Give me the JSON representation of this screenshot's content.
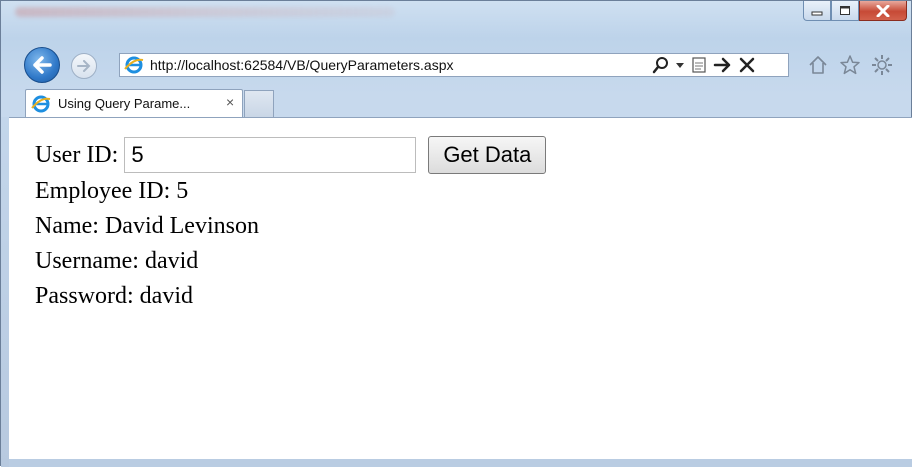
{
  "window": {
    "title_blurred": true,
    "controls": {
      "minimize": "minimize",
      "maximize": "maximize",
      "close": "close"
    }
  },
  "address_bar": {
    "url": "http://localhost:62584/VB/QueryParameters.aspx"
  },
  "tabs": [
    {
      "label": "Using Query Parame...",
      "close_glyph": "×"
    }
  ],
  "form": {
    "userid_label": "User ID:",
    "userid_value": "5",
    "button_label": "Get Data"
  },
  "results": {
    "employee_id": "Employee ID: 5",
    "name": "Name: David Levinson",
    "username": "Username: david",
    "password": "Password: david"
  },
  "colors": {
    "accent": "#2f78c8",
    "close_button": "#c74a36",
    "frame": "#c3d6eb"
  }
}
